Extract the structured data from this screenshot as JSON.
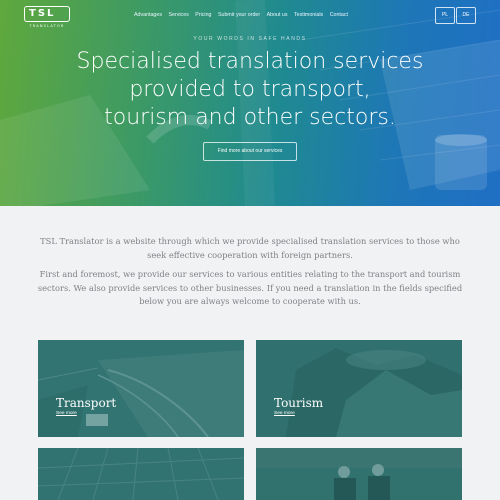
{
  "header": {
    "logo_text": "TSL",
    "logo_subtext": "TRANSLATOR",
    "nav": [
      "Advantages",
      "Services",
      "Pricing",
      "Submit your order",
      "About us",
      "Testimonials",
      "Contact"
    ],
    "languages": [
      "PL",
      "DE"
    ]
  },
  "hero": {
    "tagline": "YOUR WORDS IN SAFE HANDS",
    "headline_lines": [
      "Specialised translation services",
      "provided to transport,",
      "tourism and other sectors."
    ],
    "cta_label": "Find more about our services"
  },
  "intro": {
    "paragraph1": "TSL Translator is a website through which we provide specialised translation services to those who seek effective cooperation with foreign partners.",
    "paragraph2": "First and foremost, we provide our services to various entities relating to the transport and tourism sectors. We also provide services to other businesses. If you need a translation in the fields specified below you are always welcome to cooperate with us."
  },
  "services": [
    {
      "title": "Transport",
      "link": "See more"
    },
    {
      "title": "Tourism",
      "link": "See more"
    }
  ],
  "colors": {
    "hero_start": "#5fa83d",
    "hero_end": "#1f6fc4",
    "card_tint": "#2a6d6b"
  }
}
